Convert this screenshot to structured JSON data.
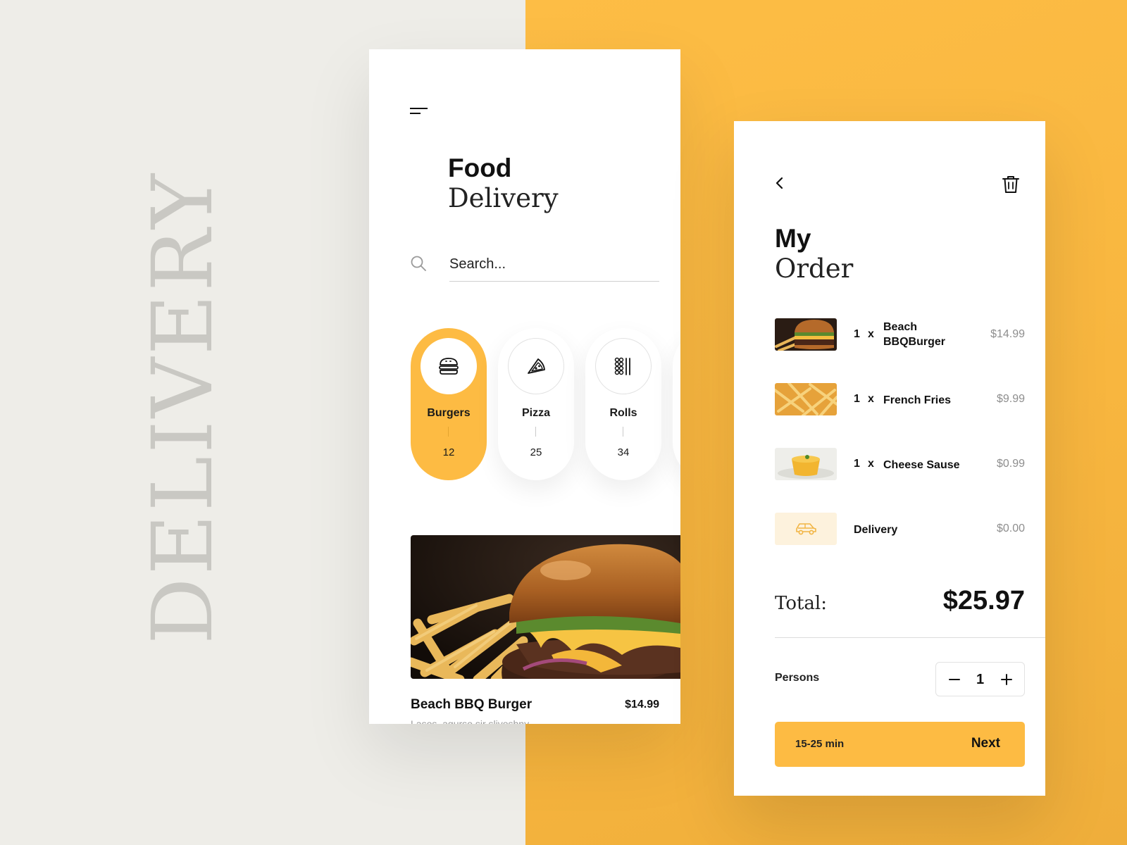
{
  "side_text": "DELIVERY",
  "colors": {
    "accent": "#fdbb43",
    "background_left": "#eeede8",
    "background_right": "#fdbd45"
  },
  "home": {
    "title_bold": "Food",
    "title_light": "Delivery",
    "search": {
      "placeholder": "Search...",
      "icon": "search-icon"
    },
    "menu_icon": "menu-icon",
    "categories": [
      {
        "label": "Burgers",
        "count": "12",
        "icon": "burger-icon",
        "active": true
      },
      {
        "label": "Pizza",
        "count": "25",
        "icon": "pizza-icon",
        "active": false
      },
      {
        "label": "Rolls",
        "count": "34",
        "icon": "rolls-icon",
        "active": false
      }
    ],
    "featured": {
      "name": "Beach BBQ Burger",
      "price": "$14.99",
      "description": "Lasos, agurso sir slivoshny"
    }
  },
  "order": {
    "title_bold": "My",
    "title_light": "Order",
    "back_icon": "chevron-left-icon",
    "trash_icon": "trash-icon",
    "items": [
      {
        "qty": "1",
        "x": "x",
        "name": "Beach BBQBurger",
        "price": "$14.99"
      },
      {
        "qty": "1",
        "x": "x",
        "name": "French Fries",
        "price": "$9.99"
      },
      {
        "qty": "1",
        "x": "x",
        "name": "Cheese Sause",
        "price": "$0.99"
      }
    ],
    "delivery": {
      "name": "Delivery",
      "price": "$0.00",
      "icon": "car-icon"
    },
    "total_label": "Total:",
    "total_value": "$25.97",
    "persons_label": "Persons",
    "persons_value": "1",
    "button": {
      "time": "15-25 min",
      "label": "Next"
    }
  }
}
